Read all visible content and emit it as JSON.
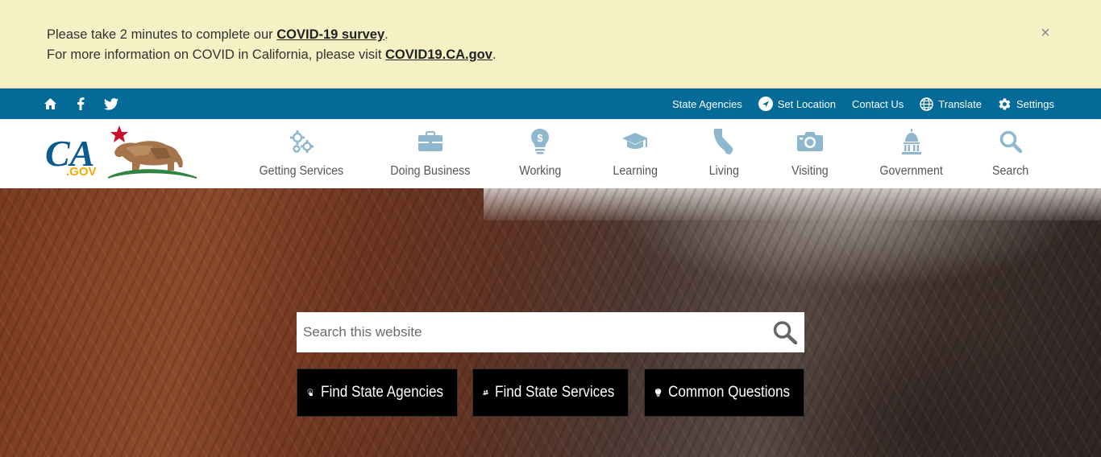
{
  "alert": {
    "line1_prefix": "Please take 2 minutes to complete our ",
    "line1_link": "COVID-19 survey",
    "line1_suffix": ".",
    "line2_prefix": "For more information on COVID in California, please visit ",
    "line2_link": "COVID19.CA.gov",
    "line2_suffix": ".",
    "close_glyph": "×"
  },
  "utility": {
    "social_icons": [
      "home-icon",
      "facebook-icon",
      "twitter-icon"
    ],
    "links": {
      "state_agencies": "State Agencies",
      "set_location": "Set Location",
      "contact_us": "Contact Us",
      "translate": "Translate",
      "settings": "Settings"
    }
  },
  "nav": {
    "getting_services": "Getting Services",
    "doing_business": "Doing Business",
    "working": "Working",
    "learning": "Learning",
    "living": "Living",
    "visiting": "Visiting",
    "government": "Government",
    "search": "Search"
  },
  "hero": {
    "search_placeholder": "Search this website",
    "buttons": {
      "agencies": "Find State Agencies",
      "services": "Find State Services",
      "questions": "Common Questions"
    }
  },
  "colors": {
    "alert_bg": "#f6f0c5",
    "utility_bg": "#046b99",
    "nav_icon": "#8fb8cf",
    "nav_text": "#555555"
  }
}
